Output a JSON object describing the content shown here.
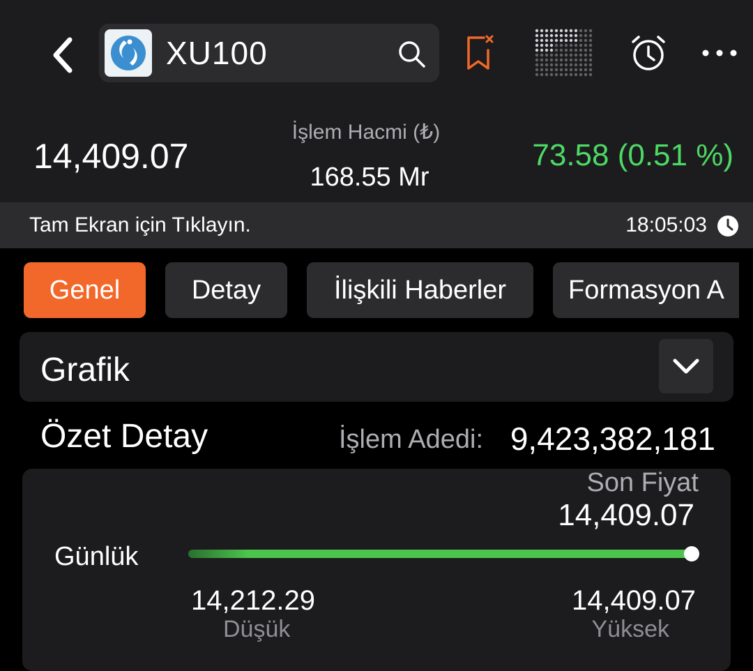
{
  "header": {
    "symbol": "XU100",
    "icons": {
      "back": "chevron-left-icon",
      "search": "search-icon",
      "bookmark": "bookmark-remove-icon",
      "grid": "dot-grid-icon",
      "alarm": "alarm-clock-icon",
      "more": "more-horizontal-icon"
    },
    "accent_color": "#f2682a"
  },
  "quote": {
    "last_price": "14,409.07",
    "volume_label": "İşlem Hacmi (₺)",
    "volume_value": "168.55 Mr",
    "change": "73.58 (0.51 %)",
    "change_color": "#4cd964"
  },
  "fullscreen_bar": {
    "text": "Tam Ekran için Tıklayın.",
    "time": "18:05:03"
  },
  "tabs": [
    {
      "label": "Genel",
      "active": true
    },
    {
      "label": "Detay",
      "active": false
    },
    {
      "label": "İlişkili Haberler",
      "active": false
    },
    {
      "label": "Formasyon A",
      "active": false
    }
  ],
  "grafik": {
    "title": "Grafik"
  },
  "summary": {
    "title": "Özet Detay",
    "count_label": "İşlem Adedi:",
    "count_value": "9,423,382,181",
    "range": {
      "son_label": "Son Fiyat",
      "son_value": "14,409.07",
      "period_label": "Günlük",
      "low_value": "14,212.29",
      "low_label": "Düşük",
      "high_value": "14,409.07",
      "high_label": "Yüksek",
      "position_fraction": 1.0,
      "fill_color": "#4cc54d"
    }
  }
}
